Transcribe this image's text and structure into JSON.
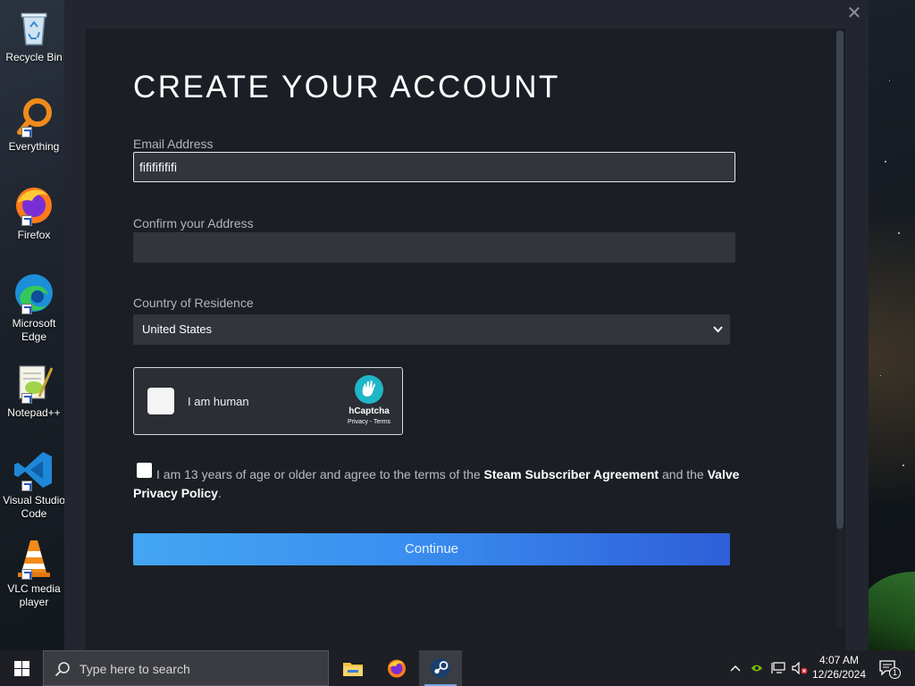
{
  "desktop": {
    "icons": [
      {
        "id": "recycle-bin",
        "label": "Recycle Bin"
      },
      {
        "id": "everything",
        "label": "Everything"
      },
      {
        "id": "firefox",
        "label": "Firefox"
      },
      {
        "id": "edge",
        "label": "Microsoft Edge"
      },
      {
        "id": "notepadpp",
        "label": "Notepad++"
      },
      {
        "id": "vscode",
        "label": "Visual Studio Code"
      },
      {
        "id": "vlc",
        "label": "VLC media player"
      }
    ]
  },
  "window": {
    "close_symbol": "✕",
    "title": "CREATE YOUR ACCOUNT",
    "email_label": "Email Address",
    "email_value": "fifififififi",
    "confirm_label": "Confirm your Address",
    "confirm_value": "",
    "country_label": "Country of Residence",
    "country_value": "United States",
    "captcha": {
      "label": "I am human",
      "brand": "hCaptcha",
      "links": "Privacy - Terms"
    },
    "agreement": {
      "part1": "I am 13 years of age or older and agree to the terms of the ",
      "link1": "Steam Subscriber Agreement",
      "part2": " and the ",
      "link2": "Valve Privacy Policy",
      "part3": "."
    },
    "continue_label": "Continue"
  },
  "taskbar": {
    "search_placeholder": "Type here to search",
    "apps": [
      "file-explorer",
      "firefox",
      "steam"
    ],
    "active_app": "steam",
    "time": "4:07 AM",
    "date": "12/26/2024",
    "notification_count": "1"
  },
  "colors": {
    "accent_blue": "#3a8ff0",
    "panel_bg": "#1b1e25",
    "input_bg": "#32353c"
  }
}
